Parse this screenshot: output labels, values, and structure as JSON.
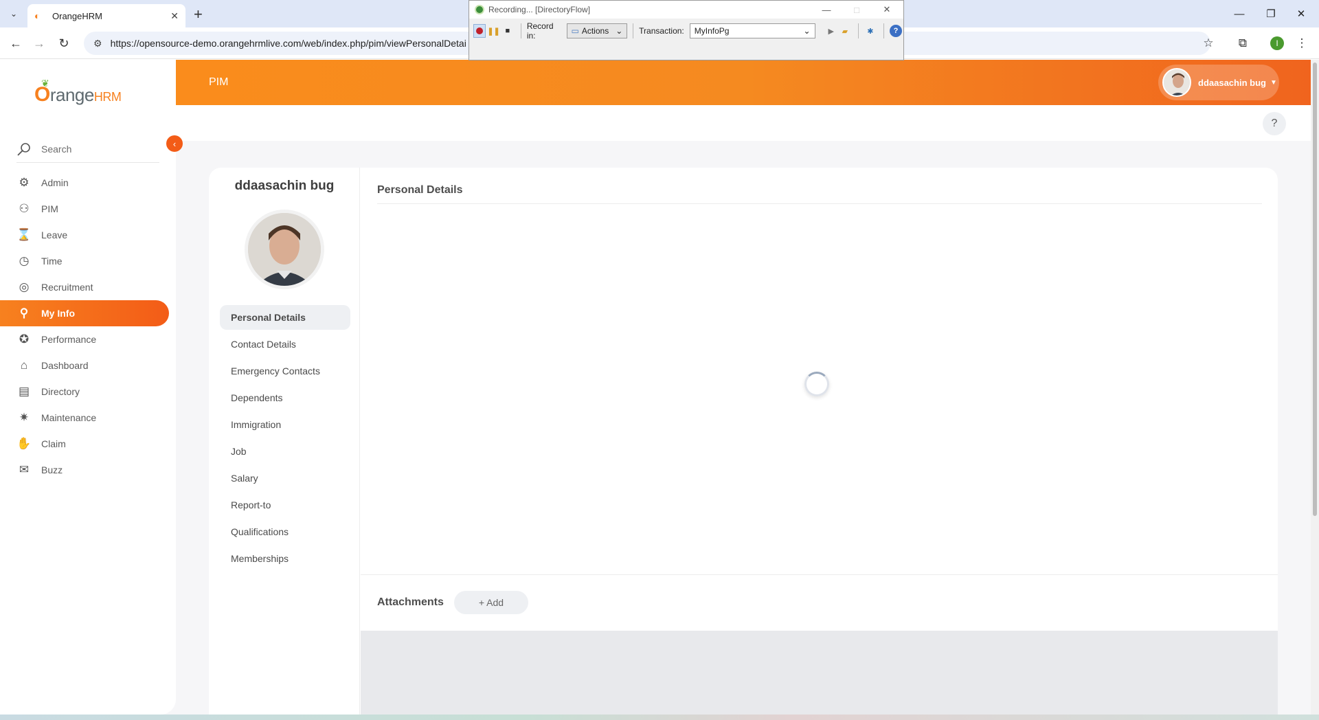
{
  "browser": {
    "tab_title": "OrangeHRM",
    "url": "https://opensource-demo.orangehrmlive.com/web/index.php/pim/viewPersonalDetai"
  },
  "recorder": {
    "title": "Recording... [DirectoryFlow]",
    "record_in_label": "Record in:",
    "record_in_value": "Actions",
    "transaction_label": "Transaction:",
    "transaction_value": "MyInfoPg"
  },
  "sidebar": {
    "logo_main": "range",
    "logo_o": "O",
    "logo_hrm": "HRM",
    "search_label": "Search",
    "items": [
      {
        "label": "Admin",
        "icon": "admin-icon"
      },
      {
        "label": "PIM",
        "icon": "pim-icon"
      },
      {
        "label": "Leave",
        "icon": "leave-icon"
      },
      {
        "label": "Time",
        "icon": "time-icon"
      },
      {
        "label": "Recruitment",
        "icon": "recruitment-icon"
      },
      {
        "label": "My Info",
        "icon": "my-info-icon",
        "active": true
      },
      {
        "label": "Performance",
        "icon": "performance-icon"
      },
      {
        "label": "Dashboard",
        "icon": "dashboard-icon"
      },
      {
        "label": "Directory",
        "icon": "directory-icon"
      },
      {
        "label": "Maintenance",
        "icon": "maintenance-icon"
      },
      {
        "label": "Claim",
        "icon": "claim-icon"
      },
      {
        "label": "Buzz",
        "icon": "buzz-icon"
      }
    ]
  },
  "header": {
    "module": "PIM",
    "user_name": "ddaasachin bug",
    "help": "?"
  },
  "profile": {
    "employee_name": "ddaasachin bug",
    "tabs": [
      {
        "label": "Personal Details",
        "active": true
      },
      {
        "label": "Contact Details"
      },
      {
        "label": "Emergency Contacts"
      },
      {
        "label": "Dependents"
      },
      {
        "label": "Immigration"
      },
      {
        "label": "Job"
      },
      {
        "label": "Salary"
      },
      {
        "label": "Report-to"
      },
      {
        "label": "Qualifications"
      },
      {
        "label": "Memberships"
      }
    ],
    "section_title": "Personal Details",
    "attachments_title": "Attachments",
    "add_label": "+ Add"
  },
  "colors": {
    "brand_orange": "#f7811f",
    "accent_red_orange": "#f35c17"
  }
}
